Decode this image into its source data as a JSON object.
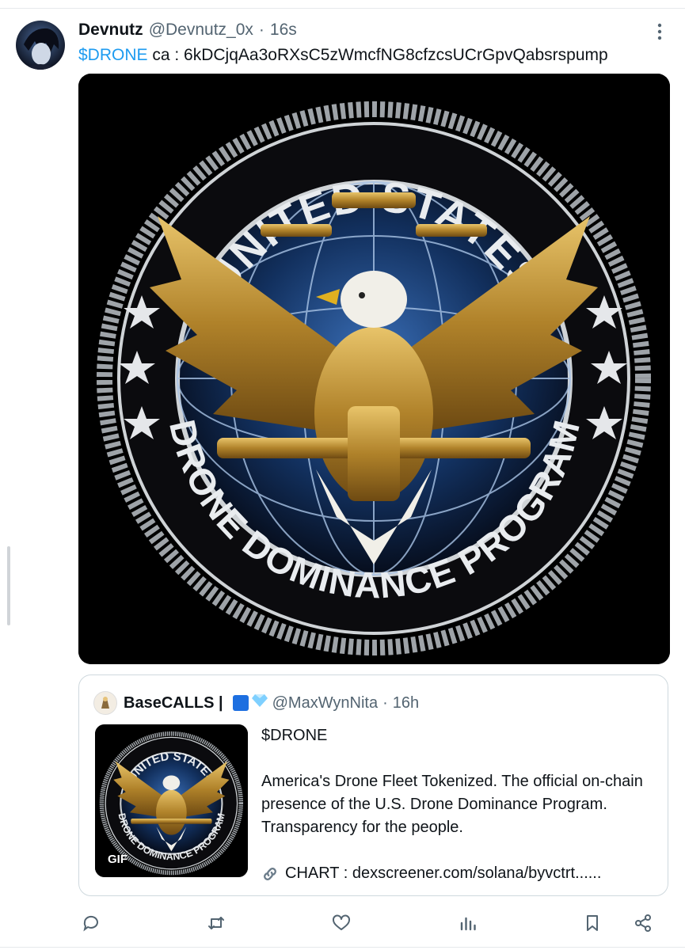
{
  "tweet": {
    "author_name": "Devnutz",
    "author_handle": "@Devnutz_0x",
    "separator": "·",
    "time": "16s",
    "cashtag": "$DRONE",
    "text_rest": " ca : 6kDCjqAa3oRXsC5zWmcfNG8cfzcsUCrGpvQabsrspump"
  },
  "media": {
    "emblem_top_text": "UNITED STATES",
    "emblem_bottom_text": "DRONE DOMINANCE PROGRAM"
  },
  "quote": {
    "author_name": "BaseCALLS |",
    "author_handle": "@MaxWynNita",
    "separator": "·",
    "time": "16h",
    "thumb_top_text": "UNITED STATES",
    "thumb_bottom_text": "DRONE DOMINANCE PROGRAM",
    "gif_badge": "GIF",
    "line1": "$DRONE",
    "line2": "America's Drone Fleet Tokenized. The official on-chain presence of the U.S. Drone Dominance Program. Transparency for the people.",
    "link_text": "CHART : dexscreener.com/solana/byvctrt......"
  },
  "actions": [
    "reply-icon",
    "retweet-icon",
    "like-icon",
    "views-icon",
    "bookmark-icon",
    "share-icon"
  ],
  "colors": {
    "accent": "#1d9bf0",
    "muted": "#536471",
    "text": "#0f1419",
    "border": "#cfd9de"
  }
}
